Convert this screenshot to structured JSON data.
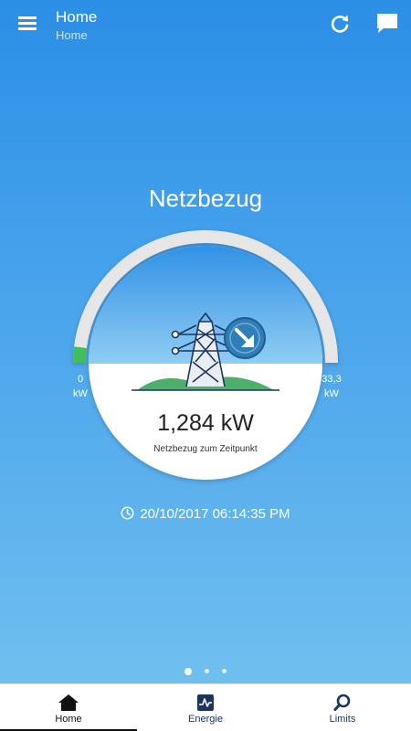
{
  "appbar": {
    "title": "Home",
    "subtitle": "Home"
  },
  "page": {
    "heading": "Netzbezug"
  },
  "gauge": {
    "value_text": "1,284 kW",
    "caption": "Netzbezug zum Zeitpunkt",
    "min_value": "0",
    "min_unit": "kW",
    "max_value": "33,3",
    "max_unit": "kW",
    "fill_fraction": 0.039,
    "fill_color": "#3fbf5a",
    "track_color": "#e8e8e8"
  },
  "timestamp": "20/10/2017 06:14:35 PM",
  "pager": {
    "count": 3,
    "active_index": 0
  },
  "bottom_nav": {
    "items": [
      {
        "label": "Home",
        "icon": "house-icon"
      },
      {
        "label": "Energie",
        "icon": "energy-chart-icon"
      },
      {
        "label": "Limits",
        "icon": "magnifier-icon"
      }
    ],
    "selected": "Home"
  },
  "colors": {
    "accent_dark": "#1c3560",
    "arrow_badge": "#2e7fb8",
    "hill_green": "#4caf6a"
  }
}
